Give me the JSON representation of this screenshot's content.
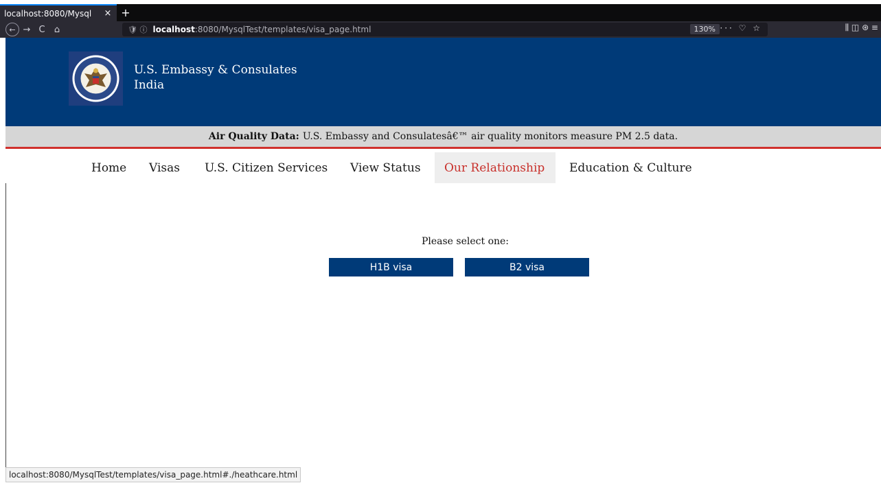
{
  "browser": {
    "tab_title": "localhost:8080/Mysql",
    "tab_close": "×",
    "new_tab": "+",
    "nav": {
      "back": "←",
      "forward": "→",
      "reload": "C",
      "home": "⌂"
    },
    "url_icons": "🛡 ⓘ",
    "url_host": "localhost",
    "url_rest": ":8080/MysqlTest/templates/visa_page.html",
    "zoom": "130%",
    "url_actions": "··· ♡ ☆",
    "tools": "⫼  ◫  ⊛  ≡",
    "status_url": "localhost:8080/MysqlTest/templates/visa_page.html#./heathcare.html"
  },
  "header": {
    "title_line1": "U.S. Embassy & Consulates",
    "title_line2": "India",
    "seal_icon": "embassy-seal"
  },
  "air_quality": {
    "label": "Air Quality Data:",
    "text": "U.S. Embassy and Consulatesâ€™ air quality monitors measure PM 2.5 data."
  },
  "nav": {
    "items": [
      {
        "label": "Home"
      },
      {
        "label": "Visas"
      },
      {
        "label": "U.S. Citizen Services"
      },
      {
        "label": "View Status"
      },
      {
        "label": "Our Relationship"
      },
      {
        "label": "Education & Culture"
      }
    ],
    "active": "Our Relationship"
  },
  "content": {
    "prompt": "Please select one:",
    "buttons": [
      {
        "label": "H1B visa"
      },
      {
        "label": "B2 visa"
      }
    ]
  },
  "colors": {
    "brand_blue": "#003a78",
    "accent_red": "#c8302b"
  }
}
